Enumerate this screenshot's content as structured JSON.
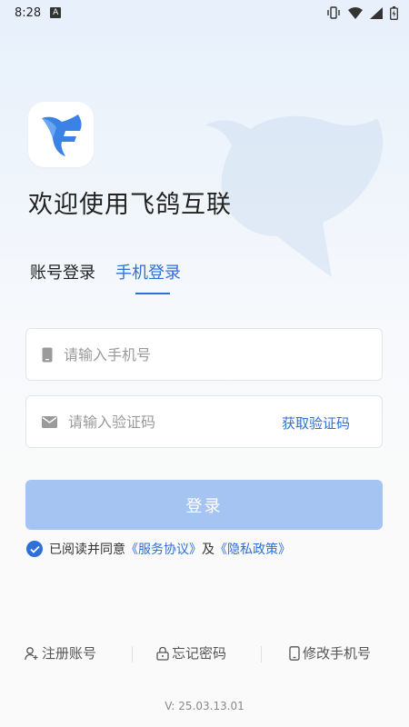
{
  "status_bar": {
    "time": "8:28",
    "notification_badge": "A"
  },
  "app": {
    "welcome": "欢迎使用飞鸽互联",
    "logo_icon": "dove-logo-icon",
    "accent_color": "#2f6fd8"
  },
  "tabs": [
    {
      "label": "账号登录",
      "active": false
    },
    {
      "label": "手机登录",
      "active": true
    }
  ],
  "phone_field": {
    "placeholder": "请输入手机号",
    "value": ""
  },
  "code_field": {
    "placeholder": "请输入验证码",
    "value": "",
    "action_label": "获取验证码"
  },
  "login_button": {
    "label": "登录"
  },
  "agreement": {
    "checked": true,
    "prefix": "已阅读并同意",
    "service_link": "《服务协议》",
    "and": "及",
    "privacy_link": "《隐私政策》"
  },
  "footer_links": {
    "register": "注册账号",
    "forgot_password": "忘记密码",
    "change_phone": "修改手机号"
  },
  "version": "V: 25.03.13.01"
}
